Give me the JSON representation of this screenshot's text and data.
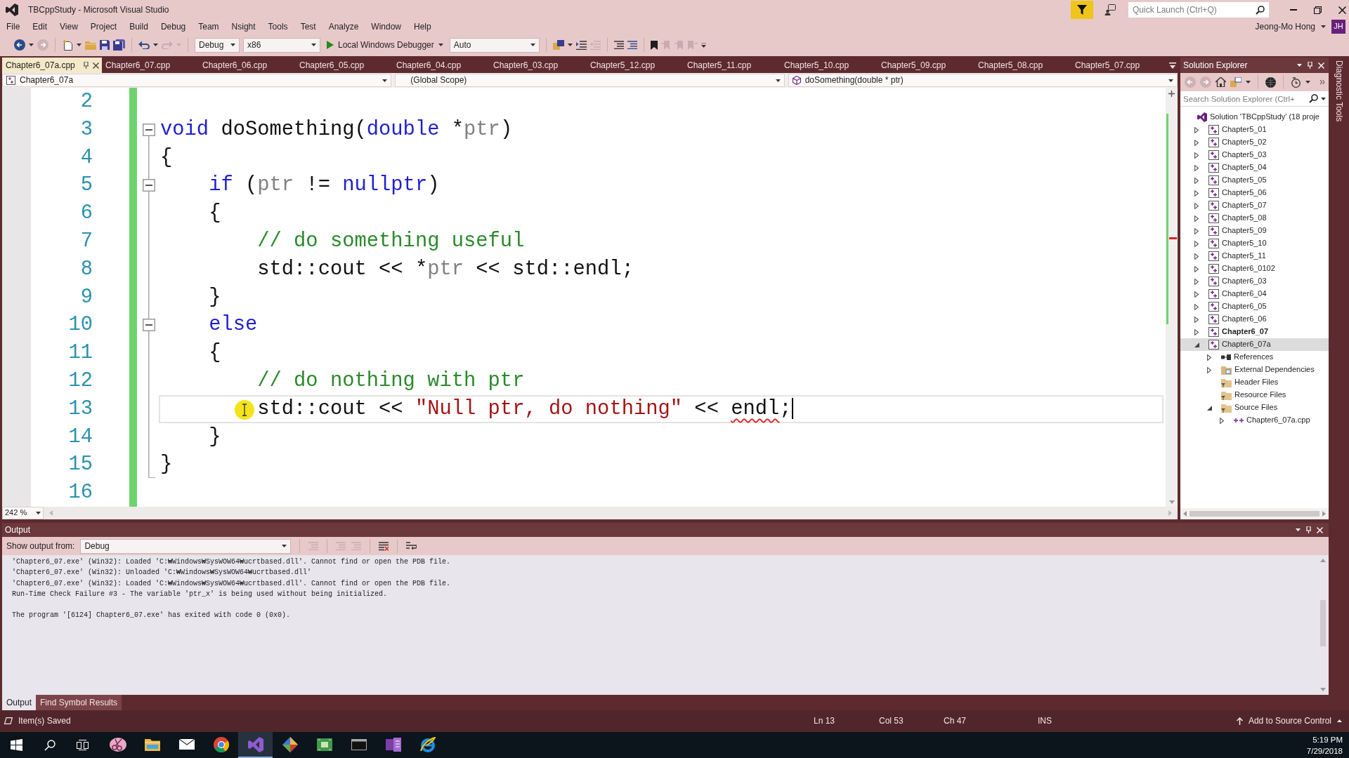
{
  "window": {
    "title": "TBCppStudy - Microsoft Visual Studio",
    "quick_launch": {
      "placeholder": "Quick Launch (Ctrl+Q)"
    },
    "user": {
      "name": "Jeong-Mo Hong",
      "initials": "JH"
    }
  },
  "menu": [
    "File",
    "Edit",
    "View",
    "Project",
    "Build",
    "Debug",
    "Team",
    "Nsight",
    "Tools",
    "Test",
    "Analyze",
    "Window",
    "Help"
  ],
  "toolbar": {
    "configuration": "Debug",
    "platform": "x86",
    "start_button": "Local Windows Debugger",
    "combo_after_start": "Auto"
  },
  "document_tabs": [
    {
      "label": "Chapter6_07a.cpp",
      "selected": true
    },
    {
      "label": "Chapter6_07.cpp",
      "selected": false
    },
    {
      "label": "Chapter6_06.cpp",
      "selected": false
    },
    {
      "label": "Chapter6_05.cpp",
      "selected": false
    },
    {
      "label": "Chapter6_04.cpp",
      "selected": false
    },
    {
      "label": "Chapter6_03.cpp",
      "selected": false
    },
    {
      "label": "Chapter5_12.cpp",
      "selected": false
    },
    {
      "label": "Chapter5_11.cpp",
      "selected": false
    },
    {
      "label": "Chapter5_10.cpp",
      "selected": false
    },
    {
      "label": "Chapter5_09.cpp",
      "selected": false
    },
    {
      "label": "Chapter5_08.cpp",
      "selected": false
    },
    {
      "label": "Chapter5_07.cpp",
      "selected": false
    }
  ],
  "navigation_bar": {
    "project": "Chapter6_07a",
    "scope": "(Global Scope)",
    "member": "doSomething(double * ptr)"
  },
  "editor": {
    "lines": [
      {
        "number": "2",
        "changed": true,
        "foldable": false,
        "current": false
      },
      {
        "number": "3",
        "changed": true,
        "foldable": true,
        "current": false,
        "tokens": [
          {
            "kind": "keyword",
            "text": "void"
          },
          {
            "kind": "plain",
            "text": " doSomething("
          },
          {
            "kind": "keyword",
            "text": "double"
          },
          {
            "kind": "plain",
            "text": " *"
          },
          {
            "kind": "parameter",
            "text": "ptr"
          },
          {
            "kind": "plain",
            "text": ")"
          }
        ]
      },
      {
        "number": "4",
        "changed": true,
        "foldable": false,
        "current": false,
        "tokens": [
          {
            "kind": "plain",
            "text": "{"
          }
        ]
      },
      {
        "number": "5",
        "changed": true,
        "foldable": true,
        "current": false,
        "tokens": [
          {
            "kind": "keyword",
            "text": "    if"
          },
          {
            "kind": "plain",
            "text": " ("
          },
          {
            "kind": "parameter",
            "text": "ptr"
          },
          {
            "kind": "plain",
            "text": " != "
          },
          {
            "kind": "keyword",
            "text": "nullptr"
          },
          {
            "kind": "plain",
            "text": ")"
          }
        ]
      },
      {
        "number": "6",
        "changed": true,
        "foldable": false,
        "current": false,
        "tokens": [
          {
            "kind": "plain",
            "text": "    {"
          }
        ]
      },
      {
        "number": "7",
        "changed": true,
        "foldable": false,
        "current": false,
        "tokens": [
          {
            "kind": "comment",
            "text": "        // do something useful"
          }
        ]
      },
      {
        "number": "8",
        "changed": true,
        "foldable": false,
        "current": false,
        "tokens": [
          {
            "kind": "plain",
            "text": "        std::cout << *"
          },
          {
            "kind": "parameter",
            "text": "ptr"
          },
          {
            "kind": "plain",
            "text": " << std::endl;"
          }
        ]
      },
      {
        "number": "9",
        "changed": true,
        "foldable": false,
        "current": false,
        "tokens": [
          {
            "kind": "plain",
            "text": "    }"
          }
        ]
      },
      {
        "number": "10",
        "changed": true,
        "foldable": true,
        "current": false,
        "tokens": [
          {
            "kind": "keyword",
            "text": "    else"
          }
        ]
      },
      {
        "number": "11",
        "changed": true,
        "foldable": false,
        "current": false,
        "tokens": [
          {
            "kind": "plain",
            "text": "    {"
          }
        ]
      },
      {
        "number": "12",
        "changed": true,
        "foldable": false,
        "current": false,
        "tokens": [
          {
            "kind": "comment",
            "text": "        // do nothing with ptr"
          }
        ]
      },
      {
        "number": "13",
        "changed": true,
        "foldable": false,
        "current": true,
        "tokens": [
          {
            "kind": "plain",
            "text": "        std::cout << "
          },
          {
            "kind": "string",
            "text": "\"Null ptr, do nothing\""
          },
          {
            "kind": "plain",
            "text": " << "
          },
          {
            "kind": "error",
            "text": "endl"
          },
          {
            "kind": "plain",
            "text": ";"
          }
        ]
      },
      {
        "number": "14",
        "changed": true,
        "foldable": false,
        "current": false,
        "tokens": [
          {
            "kind": "plain",
            "text": "    }"
          }
        ]
      },
      {
        "number": "15",
        "changed": true,
        "foldable": false,
        "current": false,
        "tokens": [
          {
            "kind": "plain",
            "text": "}"
          }
        ]
      },
      {
        "number": "16",
        "changed": true,
        "foldable": false,
        "current": false
      }
    ],
    "zoom": "242 %"
  },
  "solution_explorer": {
    "title": "Solution Explorer",
    "search": {
      "placeholder": "Search Solution Explorer (Ctrl+"
    },
    "tree": [
      {
        "label": "Solution 'TBCppStudy' (18 proje",
        "kind": "solution",
        "selected": false,
        "children": [
          {
            "label": "Chapter5_01",
            "kind": "project",
            "expanded": false,
            "selected": false,
            "startup": false
          },
          {
            "label": "Chapter5_02",
            "kind": "project",
            "expanded": false,
            "selected": false,
            "startup": false
          },
          {
            "label": "Chapter5_03",
            "kind": "project",
            "expanded": false,
            "selected": false,
            "startup": false
          },
          {
            "label": "Chapter5_04",
            "kind": "project",
            "expanded": false,
            "selected": false,
            "startup": false
          },
          {
            "label": "Chapter5_05",
            "kind": "project",
            "expanded": false,
            "selected": false,
            "startup": false
          },
          {
            "label": "Chapter5_06",
            "kind": "project",
            "expanded": false,
            "selected": false,
            "startup": false
          },
          {
            "label": "Chapter5_07",
            "kind": "project",
            "expanded": false,
            "selected": false,
            "startup": false
          },
          {
            "label": "Chapter5_08",
            "kind": "project",
            "expanded": false,
            "selected": false,
            "startup": false
          },
          {
            "label": "Chapter5_09",
            "kind": "project",
            "expanded": false,
            "selected": false,
            "startup": false
          },
          {
            "label": "Chapter5_10",
            "kind": "project",
            "expanded": false,
            "selected": false,
            "startup": false
          },
          {
            "label": "Chapter5_11",
            "kind": "project",
            "expanded": false,
            "selected": false,
            "startup": false
          },
          {
            "label": "Chapter6_0102",
            "kind": "project",
            "expanded": false,
            "selected": false,
            "startup": false
          },
          {
            "label": "Chapter6_03",
            "kind": "project",
            "expanded": false,
            "selected": false,
            "startup": false
          },
          {
            "label": "Chapter6_04",
            "kind": "project",
            "expanded": false,
            "selected": false,
            "startup": false
          },
          {
            "label": "Chapter6_05",
            "kind": "project",
            "expanded": false,
            "selected": false,
            "startup": false
          },
          {
            "label": "Chapter6_06",
            "kind": "project",
            "expanded": false,
            "selected": false,
            "startup": false
          },
          {
            "label": "Chapter6_07",
            "kind": "project",
            "expanded": false,
            "selected": false,
            "startup": true
          },
          {
            "label": "Chapter6_07a",
            "kind": "project",
            "expanded": true,
            "selected": true,
            "startup": false,
            "children": [
              {
                "label": "References",
                "kind": "references",
                "expanded": false,
                "selected": false
              },
              {
                "label": "External Dependencies",
                "kind": "dependencies",
                "expanded": false,
                "selected": false
              },
              {
                "label": "Header Files",
                "kind": "filter",
                "selected": false
              },
              {
                "label": "Resource Files",
                "kind": "filter",
                "selected": false
              },
              {
                "label": "Source Files",
                "kind": "filter",
                "expanded": true,
                "selected": false,
                "children": [
                  {
                    "label": "Chapter6_07a.cpp",
                    "kind": "file",
                    "expanded": false,
                    "selected": false
                  }
                ]
              }
            ]
          }
        ]
      }
    ]
  },
  "side_tab": "Diagnostic Tools",
  "output": {
    "title": "Output",
    "source_label": "Show output from:",
    "source": "Debug",
    "blocks": [
      [
        "'Chapter6_07.exe' (Win32): Loaded 'C:₩Windows₩SysWOW64₩ucrtbased.dll'. Cannot find or open the PDB file.",
        "'Chapter6_07.exe' (Win32): Unloaded 'C:₩Windows₩SysWOW64₩ucrtbased.dll'",
        "'Chapter6_07.exe' (Win32): Loaded 'C:₩Windows₩SysWOW64₩ucrtbased.dll'. Cannot find or open the PDB file.",
        "Run-Time Check Failure #3 - The variable 'ptr_x' is being used without being initialized."
      ],
      [
        "The program '[6124] Chapter6_07.exe' has exited with code 0 (0x0)."
      ]
    ],
    "tabs": [
      {
        "label": "Output",
        "selected": true
      },
      {
        "label": "Find Symbol Results",
        "selected": false
      }
    ]
  },
  "status_bar": {
    "message": "Item(s) Saved",
    "line": "Ln 13",
    "column": "Col 53",
    "character": "Ch 47",
    "mode": "INS",
    "source_control": "Add to Source Control"
  },
  "taskbar": {
    "apps": [
      {
        "kind": "scissors",
        "selected": false
      },
      {
        "kind": "folder",
        "selected": false
      },
      {
        "kind": "envelope",
        "selected": false
      },
      {
        "kind": "round_logo",
        "selected": false
      },
      {
        "kind": "ribbon",
        "selected": true
      },
      {
        "kind": "diamond",
        "selected": false
      },
      {
        "kind": "board",
        "selected": false
      },
      {
        "kind": "terminal",
        "selected": false
      },
      {
        "kind": "notebook",
        "selected": false
      },
      {
        "kind": "orbit",
        "selected": false
      }
    ],
    "time": "5:19 PM",
    "date": "7/29/2018"
  }
}
